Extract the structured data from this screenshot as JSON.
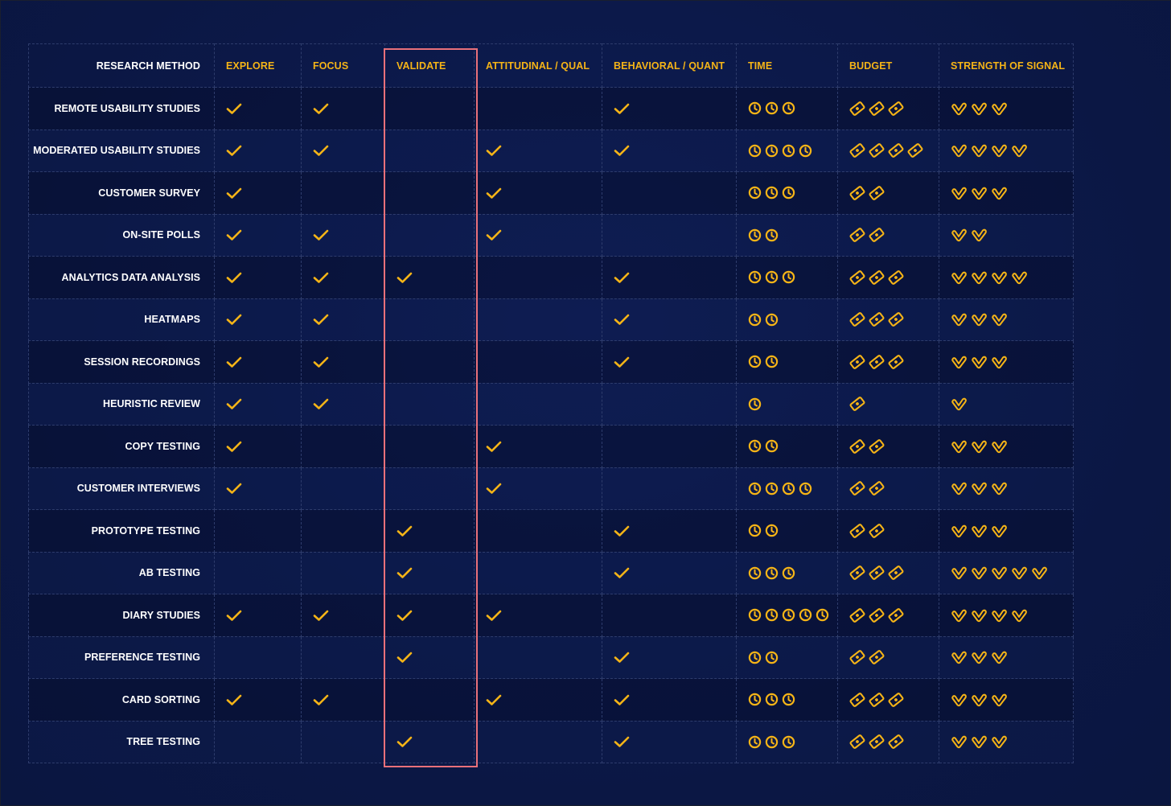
{
  "table": {
    "headers": {
      "method": "RESEARCH METHOD",
      "explore": "EXPLORE",
      "focus": "FOCUS",
      "validate": "VALIDATE",
      "attitudinal": "ATTITUDINAL / QUAL",
      "behavioral": "BEHAVIORAL / QUANT",
      "time": "TIME",
      "budget": "BUDGET",
      "signal": "STRENGTH OF SIGNAL"
    },
    "rows": [
      {
        "method": "REMOTE USABILITY STUDIES",
        "explore": true,
        "focus": true,
        "validate": false,
        "attitudinal": false,
        "behavioral": true,
        "time": 3,
        "budget": 3,
        "signal": 3
      },
      {
        "method": "MODERATED USABILITY STUDIES",
        "explore": true,
        "focus": true,
        "validate": false,
        "attitudinal": true,
        "behavioral": true,
        "time": 4,
        "budget": 4,
        "signal": 4
      },
      {
        "method": "CUSTOMER SURVEY",
        "explore": true,
        "focus": false,
        "validate": false,
        "attitudinal": true,
        "behavioral": false,
        "time": 3,
        "budget": 2,
        "signal": 3
      },
      {
        "method": "ON-SITE POLLS",
        "explore": true,
        "focus": true,
        "validate": false,
        "attitudinal": true,
        "behavioral": false,
        "time": 2,
        "budget": 2,
        "signal": 2
      },
      {
        "method": "ANALYTICS DATA ANALYSIS",
        "explore": true,
        "focus": true,
        "validate": true,
        "attitudinal": false,
        "behavioral": true,
        "time": 3,
        "budget": 3,
        "signal": 4
      },
      {
        "method": "HEATMAPS",
        "explore": true,
        "focus": true,
        "validate": false,
        "attitudinal": false,
        "behavioral": true,
        "time": 2,
        "budget": 3,
        "signal": 3
      },
      {
        "method": "SESSION RECORDINGS",
        "explore": true,
        "focus": true,
        "validate": false,
        "attitudinal": false,
        "behavioral": true,
        "time": 2,
        "budget": 3,
        "signal": 3
      },
      {
        "method": "HEURISTIC REVIEW",
        "explore": true,
        "focus": true,
        "validate": false,
        "attitudinal": false,
        "behavioral": false,
        "time": 1,
        "budget": 1,
        "signal": 1
      },
      {
        "method": "COPY TESTING",
        "explore": true,
        "focus": false,
        "validate": false,
        "attitudinal": true,
        "behavioral": false,
        "time": 2,
        "budget": 2,
        "signal": 3
      },
      {
        "method": "CUSTOMER INTERVIEWS",
        "explore": true,
        "focus": false,
        "validate": false,
        "attitudinal": true,
        "behavioral": false,
        "time": 4,
        "budget": 2,
        "signal": 3
      },
      {
        "method": "PROTOTYPE TESTING",
        "explore": false,
        "focus": false,
        "validate": true,
        "attitudinal": false,
        "behavioral": true,
        "time": 2,
        "budget": 2,
        "signal": 3
      },
      {
        "method": "AB TESTING",
        "explore": false,
        "focus": false,
        "validate": true,
        "attitudinal": false,
        "behavioral": true,
        "time": 3,
        "budget": 3,
        "signal": 5
      },
      {
        "method": "DIARY STUDIES",
        "explore": true,
        "focus": true,
        "validate": true,
        "attitudinal": true,
        "behavioral": false,
        "time": 5,
        "budget": 3,
        "signal": 4
      },
      {
        "method": "PREFERENCE TESTING",
        "explore": false,
        "focus": false,
        "validate": true,
        "attitudinal": false,
        "behavioral": true,
        "time": 2,
        "budget": 2,
        "signal": 3
      },
      {
        "method": "CARD SORTING",
        "explore": true,
        "focus": true,
        "validate": false,
        "attitudinal": true,
        "behavioral": true,
        "time": 3,
        "budget": 3,
        "signal": 3
      },
      {
        "method": "TREE TESTING",
        "explore": false,
        "focus": false,
        "validate": true,
        "attitudinal": false,
        "behavioral": true,
        "time": 3,
        "budget": 3,
        "signal": 3
      }
    ]
  },
  "icons": {
    "check": "check-icon",
    "time": "clock-icon",
    "budget": "money-icon",
    "signal": "signal-check-icon"
  },
  "colors": {
    "background": "#0c1a48",
    "accent": "#f5b417",
    "method_text": "#ffffff",
    "grid": "#2e3c6c",
    "highlight_box": "#e8707a"
  }
}
